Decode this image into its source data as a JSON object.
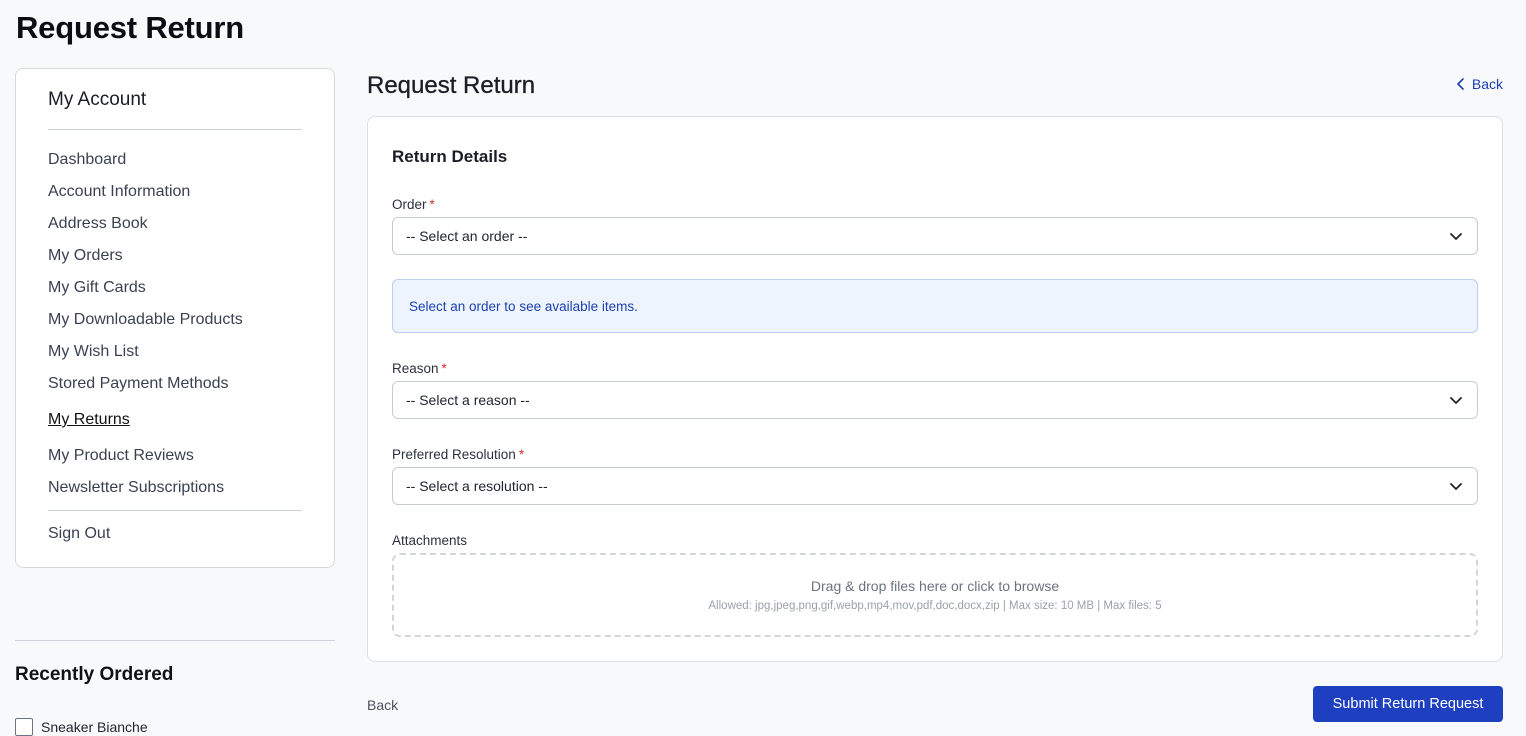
{
  "page": {
    "title": "Request Return"
  },
  "sidebar": {
    "heading": "My Account",
    "items": [
      {
        "label": "Dashboard"
      },
      {
        "label": "Account Information"
      },
      {
        "label": "Address Book"
      },
      {
        "label": "My Orders"
      },
      {
        "label": "My Gift Cards"
      },
      {
        "label": "My Downloadable Products"
      },
      {
        "label": "My Wish List"
      },
      {
        "label": "Stored Payment Methods"
      },
      {
        "label": "My Returns",
        "active": true
      },
      {
        "label": "My Product Reviews"
      },
      {
        "label": "Newsletter Subscriptions"
      }
    ],
    "sign_out": "Sign Out"
  },
  "recently_ordered": {
    "title": "Recently Ordered",
    "items": [
      {
        "name": "Sneaker Bianche",
        "checked": false
      }
    ]
  },
  "main": {
    "title": "Request Return",
    "back_label": "Back",
    "card_title": "Return Details",
    "order": {
      "label": "Order",
      "required_mark": "*",
      "value": "-- Select an order --"
    },
    "info_message": "Select an order to see available items.",
    "reason": {
      "label": "Reason",
      "required_mark": "*",
      "value": "-- Select a reason --"
    },
    "resolution": {
      "label": "Preferred Resolution",
      "required_mark": "*",
      "value": "-- Select a resolution --"
    },
    "attachments": {
      "label": "Attachments",
      "dropzone_text": "Drag & drop files here or click to browse",
      "dropzone_hint": "Allowed: jpg,jpeg,png,gif,webp,mp4,mov,pdf,doc,docx,zip | Max size: 10 MB | Max files: 5"
    }
  },
  "footer": {
    "back_label": "Back",
    "submit_label": "Submit Return Request"
  },
  "colors": {
    "primary": "#1e40c0",
    "link": "#1d3fb0",
    "info_bg": "#eef4fd",
    "required": "#d32f2f"
  }
}
